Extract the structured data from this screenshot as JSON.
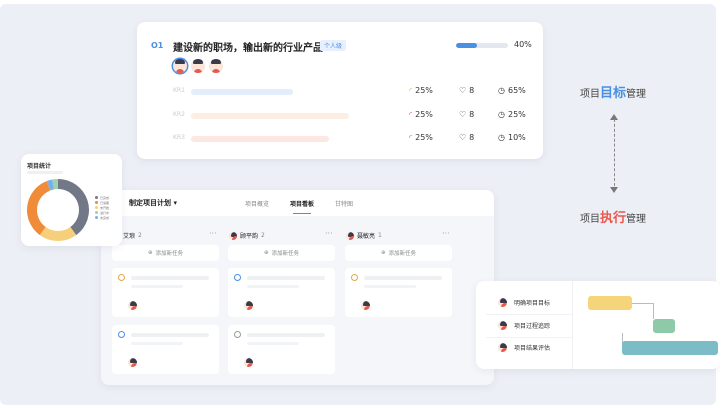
{
  "okr": {
    "objective_tag": "O1",
    "objective_title": "建设新的职场，输出新的行业产品",
    "objective_badge": "个人级",
    "objective_progress_label": "40%",
    "objective_progress": 0.4,
    "key_results": [
      {
        "label": "KR1",
        "progress": "25%",
        "likes": "8",
        "completion": "65%",
        "bar_color": "#e3edfb"
      },
      {
        "label": "KR2",
        "progress": "25%",
        "likes": "8",
        "completion": "25%",
        "bar_color": "#fdeee3"
      },
      {
        "label": "KR3",
        "progress": "25%",
        "likes": "8",
        "completion": "10%",
        "bar_color": "#fde7e3"
      }
    ]
  },
  "side": {
    "goal_prefix": "项目",
    "goal_highlight": "目标",
    "goal_suffix": "管理",
    "goal_color": "#4a90e2",
    "exec_prefix": "项目",
    "exec_highlight": "执行",
    "exec_suffix": "管理",
    "exec_color": "#e8584e"
  },
  "stats": {
    "title": "项目统计",
    "legend": [
      "已完成",
      "已逾期",
      "未开始",
      "进行中",
      "未完成"
    ],
    "slices": [
      {
        "value": 40,
        "color": "#727888"
      },
      {
        "value": 20,
        "color": "#f5cf7a"
      },
      {
        "value": 34,
        "color": "#f08b3a"
      },
      {
        "value": 3,
        "color": "#7ab0e8"
      },
      {
        "value": 3,
        "color": "#9fd0b0"
      }
    ]
  },
  "board": {
    "title": "制定项目计划",
    "tabs": [
      "项目概览",
      "项目看板",
      "甘特图"
    ],
    "columns": [
      {
        "name": "艾琅",
        "count": "2",
        "add_label": "添加新任务"
      },
      {
        "name": "顾平韵",
        "count": "2",
        "add_label": "添加新任务"
      },
      {
        "name": "聂敏亮",
        "count": "1",
        "add_label": "添加新任务"
      }
    ],
    "more": "···"
  },
  "gantt": {
    "tasks": [
      "明确项目目标",
      "项目过程追踪",
      "项目结果评估"
    ],
    "colors": [
      "#f5d47a",
      "#8ecaa8",
      "#7bbcc6"
    ]
  }
}
